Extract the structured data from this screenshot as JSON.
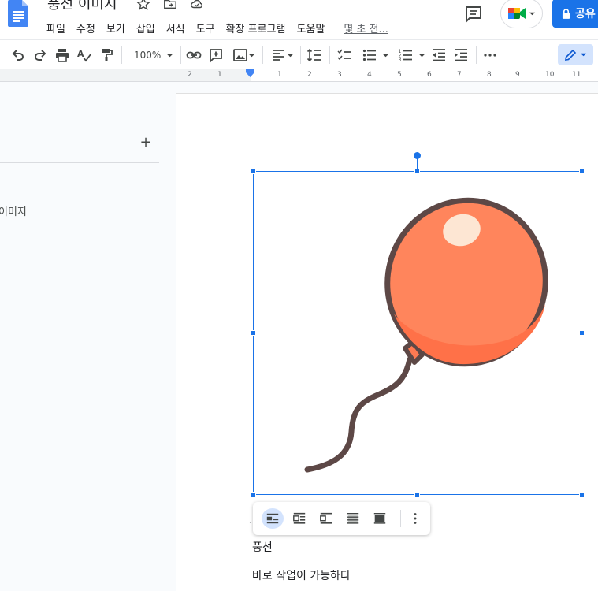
{
  "document": {
    "title": "풍선 이미지"
  },
  "menu": {
    "items": [
      "파일",
      "수정",
      "보기",
      "삽입",
      "서식",
      "도구",
      "확장 프로그램",
      "도움말"
    ],
    "last_edit": "몇 초 전..."
  },
  "header": {
    "share_label": "공유"
  },
  "toolbar": {
    "zoom": "100%"
  },
  "ruler": {
    "numbers": [
      "2",
      "1",
      "1",
      "2",
      "3",
      "4",
      "5",
      "6",
      "7",
      "8",
      "9",
      "10",
      "11"
    ]
  },
  "outline": {
    "heading_item": "이미지"
  },
  "body": {
    "caption": "풍선",
    "line2": "바로 작업이 가능하다"
  },
  "colors": {
    "accent": "#1a73e8",
    "balloon_fill": "#ff855c",
    "balloon_outline": "#5d4846",
    "highlight": "#fde6d3"
  }
}
